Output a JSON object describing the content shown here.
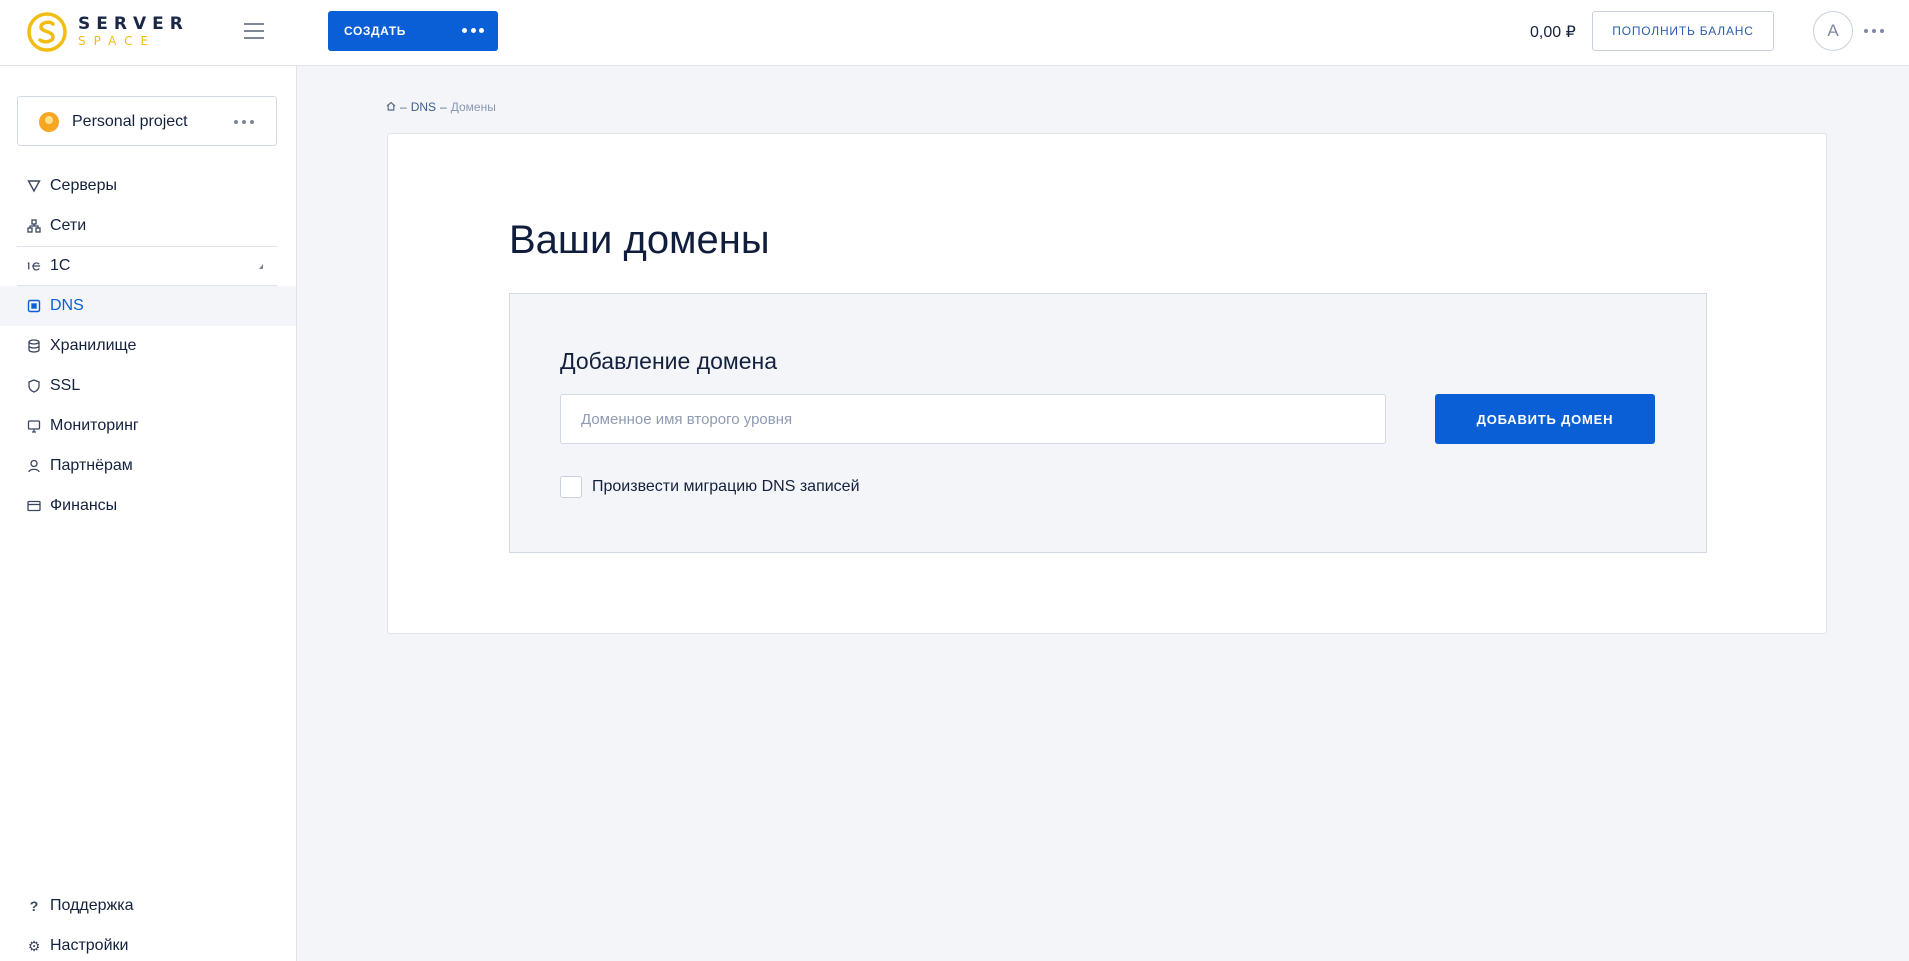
{
  "header": {
    "logo": {
      "word1": "SERVER",
      "word2": "SPACE"
    },
    "create_label": "СОЗДАТЬ",
    "balance": "0,00 ₽",
    "topup_label": "ПОПОЛНИТЬ БАЛАНС",
    "avatar_letter": "A"
  },
  "sidebar": {
    "project_name": "Personal project",
    "items": [
      {
        "label": "Серверы",
        "icon": "triangle-down-icon"
      },
      {
        "label": "Сети",
        "icon": "network-icon"
      },
      {
        "label": "1С",
        "icon": "one-c-icon"
      },
      {
        "label": "DNS",
        "icon": "dns-icon"
      },
      {
        "label": "Хранилище",
        "icon": "database-icon"
      },
      {
        "label": "SSL",
        "icon": "shield-icon"
      },
      {
        "label": "Мониторинг",
        "icon": "monitor-icon"
      },
      {
        "label": "Партнёрам",
        "icon": "person-icon"
      },
      {
        "label": "Финансы",
        "icon": "card-icon"
      }
    ],
    "active_item": "DNS",
    "bottom_items": [
      {
        "label": "Поддержка",
        "icon": "question-icon"
      },
      {
        "label": "Настройки",
        "icon": "gear-icon"
      }
    ]
  },
  "breadcrumb": {
    "home_icon": "home-icon",
    "section": "DNS",
    "current": "Домены"
  },
  "main": {
    "title": "Ваши домены",
    "panel": {
      "title": "Добавление домена",
      "input_value": "",
      "input_placeholder": "Доменное имя второго уровня",
      "add_button": "ДОБАВИТЬ ДОМЕН",
      "migrate_label": "Произвести миграцию DNS записей",
      "migrate_checked": false
    }
  },
  "colors": {
    "accent": "#0a5fd6",
    "brand_yellow": "#f1bd13",
    "background": "#f3f5f9",
    "text": "#14213d"
  }
}
